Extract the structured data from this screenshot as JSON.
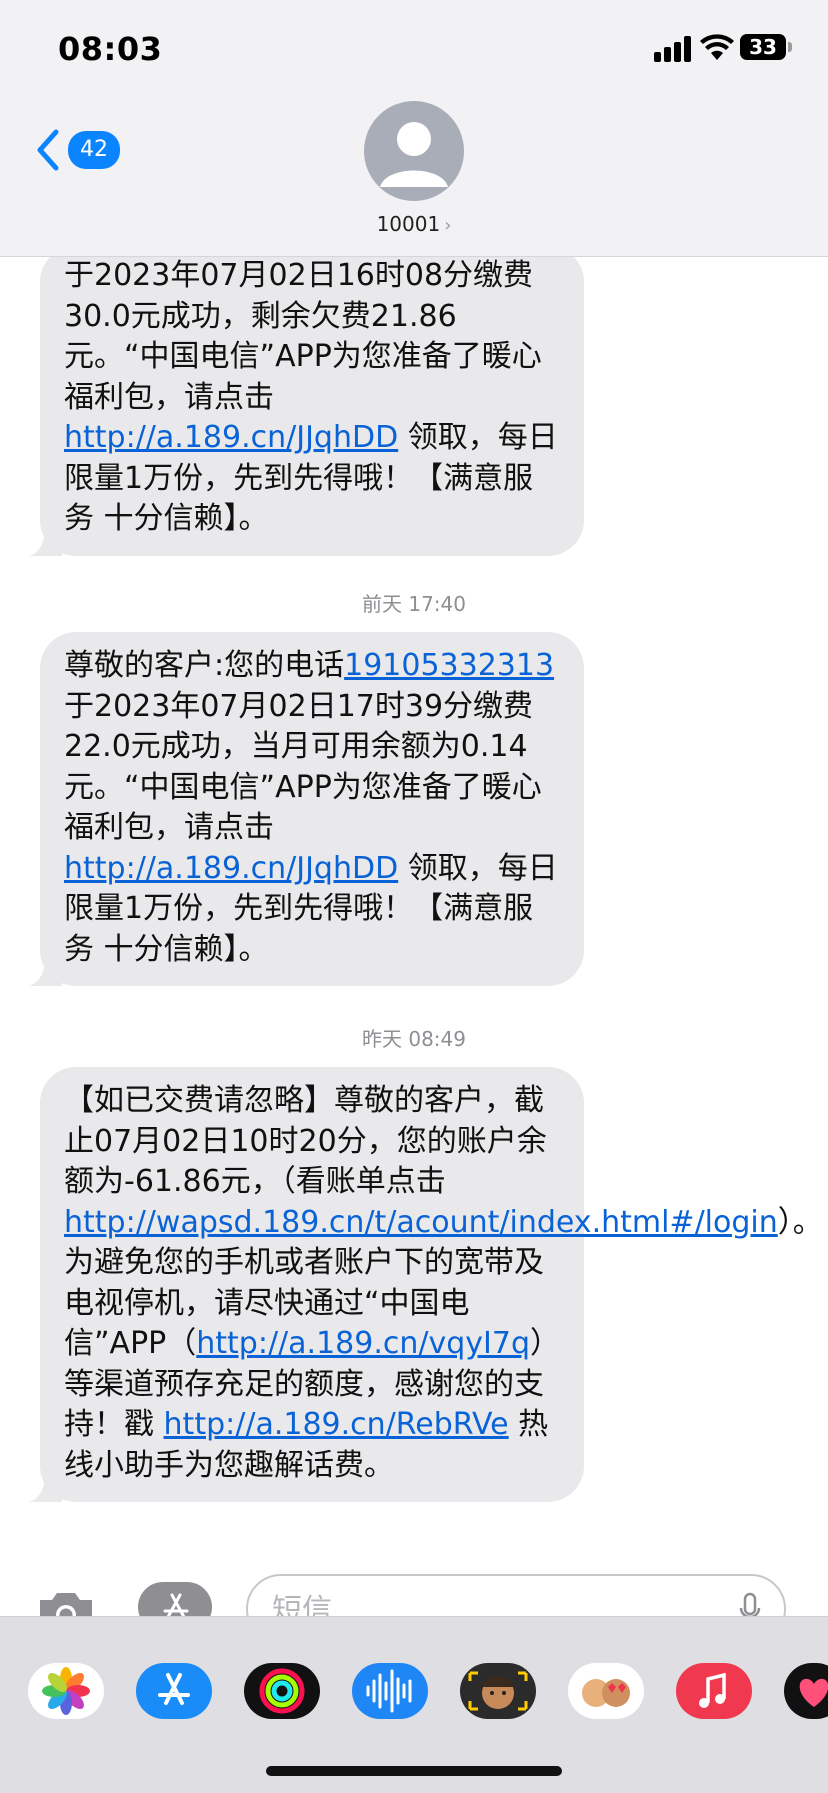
{
  "status_bar": {
    "time": "08:03",
    "battery": "33"
  },
  "header": {
    "back_count": "42",
    "contact_name": "10001",
    "contact_chevron": "›"
  },
  "messages": [
    {
      "segments": [
        {
          "t": "于2023年07月02日16时08分缴费30.0元成功，剩余欠费21.86元。“中国电信”APP为您准备了暖心福利包，请点击 "
        },
        {
          "t": "http://a.189.cn/JJqhDD",
          "link": true
        },
        {
          "t": " 领取，每日限量1万份，先到先得哦！【满意服务 十分信赖】。"
        }
      ]
    },
    {
      "timestamp": "前天 17:40",
      "segments": [
        {
          "t": "尊敬的客户:您的电话"
        },
        {
          "t": "19105332313",
          "link": true
        },
        {
          "t": "于2023年07月02日17时39分缴费22.0元成功，当月可用余额为0.14元。“中国电信”APP为您准备了暖心福利包，请点击 "
        },
        {
          "t": "http://a.189.cn/JJqhDD",
          "link": true
        },
        {
          "t": " 领取，每日限量1万份，先到先得哦！【满意服务 十分信赖】。"
        }
      ]
    },
    {
      "timestamp": "昨天 08:49",
      "segments": [
        {
          "t": "【如已交费请忽略】尊敬的客户，截止07月02日10时20分，您的账户余额为-61.86元，（看账单点击"
        },
        {
          "t": "http://wapsd.189.cn/t/acount/index.html#/login",
          "link": true
        },
        {
          "t": "）。为避免您的手机或者账户下的宽带及电视停机，请尽快通过“中国电信”APP（"
        },
        {
          "t": "http://a.189.cn/vqyI7q",
          "link": true
        },
        {
          "t": "）等渠道预存充足的额度，感谢您的支持！戳 "
        },
        {
          "t": "http://a.189.cn/RebRVe",
          "link": true
        },
        {
          "t": " 热线小助手为您趣解话费。"
        }
      ]
    }
  ],
  "input": {
    "placeholder": "短信",
    "value": ""
  },
  "app_drawer": [
    {
      "name": "photos-app-icon"
    },
    {
      "name": "app-store-app-icon"
    },
    {
      "name": "fitness-app-icon"
    },
    {
      "name": "voice-memos-app-icon"
    },
    {
      "name": "memoji-app-icon"
    },
    {
      "name": "animoji-stickers-app-icon"
    },
    {
      "name": "music-app-icon"
    },
    {
      "name": "heart-sticker-app-icon"
    }
  ],
  "colors": {
    "link": "#0a63d6",
    "bubble": "#e9e9eb",
    "accent": "#0a84ff"
  }
}
